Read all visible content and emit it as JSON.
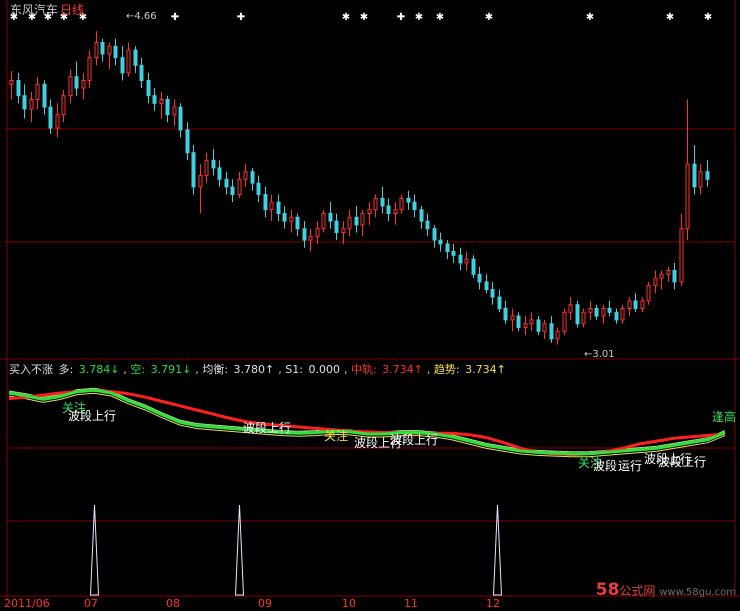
{
  "header": {
    "stock_name": "东风汽车",
    "period": "日线"
  },
  "price_labels": {
    "high": "4.66",
    "low": "3.01"
  },
  "indicator": {
    "name": "买入不涨",
    "items": [
      {
        "label": "多: ",
        "value": "3.784↓",
        "color": "g"
      },
      {
        "label": "空: ",
        "value": "3.791↓",
        "color": "g"
      },
      {
        "label": "均衡: ",
        "value": "3.780↑",
        "color": "w"
      },
      {
        "label": "S1: ",
        "value": "0.000",
        "color": "w"
      },
      {
        "label": "中轨: ",
        "value": "3.734↑",
        "color": "r"
      },
      {
        "label": "趋势: ",
        "value": "3.734↑",
        "color": "y"
      }
    ]
  },
  "signals": [
    {
      "text": "关注",
      "color": "g"
    },
    {
      "text": "波段上行",
      "color": "w"
    },
    {
      "text": "波段上行",
      "color": "w"
    },
    {
      "text": "关注",
      "color": "y"
    },
    {
      "text": "波段上行",
      "color": "w"
    },
    {
      "text": "波段上行",
      "color": "w"
    },
    {
      "text": "关注",
      "color": "g"
    },
    {
      "text": "波段",
      "color": "w"
    },
    {
      "text": "运行",
      "color": "w"
    },
    {
      "text": "波段上行",
      "color": "w"
    },
    {
      "text": "波段上行",
      "color": "w"
    },
    {
      "text": "逢高",
      "color": "g"
    }
  ],
  "dates": [
    "2011/06",
    "07",
    "08",
    "09",
    "10",
    "11",
    "12"
  ],
  "watermark": {
    "big": "58",
    "brand": "公式网",
    "site": "www.58gu.com"
  },
  "colors": {
    "up": "#ff3030",
    "down": "#40d0e0",
    "grid": "#800000",
    "trend": "#ff2020",
    "fast": "#30e040",
    "thin": "#e0e060"
  },
  "chart_data": {
    "type": "candlestick",
    "price_range": [
      2.95,
      4.75
    ],
    "candles": [
      [
        4.38,
        4.45,
        4.3,
        4.4
      ],
      [
        4.4,
        4.44,
        4.28,
        4.32
      ],
      [
        4.32,
        4.38,
        4.2,
        4.25
      ],
      [
        4.25,
        4.34,
        4.18,
        4.3
      ],
      [
        4.3,
        4.42,
        4.25,
        4.38
      ],
      [
        4.38,
        4.4,
        4.22,
        4.26
      ],
      [
        4.26,
        4.3,
        4.12,
        4.15
      ],
      [
        4.15,
        4.28,
        4.1,
        4.22
      ],
      [
        4.22,
        4.35,
        4.18,
        4.32
      ],
      [
        4.32,
        4.46,
        4.28,
        4.42
      ],
      [
        4.42,
        4.5,
        4.32,
        4.36
      ],
      [
        4.36,
        4.44,
        4.3,
        4.4
      ],
      [
        4.4,
        4.56,
        4.36,
        4.52
      ],
      [
        4.52,
        4.66,
        4.48,
        4.6
      ],
      [
        4.6,
        4.62,
        4.5,
        4.54
      ],
      [
        4.54,
        4.6,
        4.46,
        4.58
      ],
      [
        4.58,
        4.62,
        4.48,
        4.52
      ],
      [
        4.52,
        4.58,
        4.4,
        4.44
      ],
      [
        4.44,
        4.6,
        4.42,
        4.56
      ],
      [
        4.56,
        4.58,
        4.44,
        4.48
      ],
      [
        4.48,
        4.52,
        4.36,
        4.4
      ],
      [
        4.4,
        4.44,
        4.28,
        4.32
      ],
      [
        4.32,
        4.36,
        4.24,
        4.28
      ],
      [
        4.28,
        4.34,
        4.2,
        4.3
      ],
      [
        4.3,
        4.32,
        4.18,
        4.22
      ],
      [
        4.22,
        4.3,
        4.16,
        4.26
      ],
      [
        4.26,
        4.28,
        4.1,
        4.14
      ],
      [
        4.14,
        4.18,
        3.98,
        4.02
      ],
      [
        4.02,
        4.06,
        3.8,
        3.84
      ],
      [
        3.84,
        3.96,
        3.7,
        3.9
      ],
      [
        3.9,
        4.02,
        3.86,
        3.98
      ],
      [
        3.98,
        4.04,
        3.9,
        3.94
      ],
      [
        3.94,
        3.98,
        3.84,
        3.88
      ],
      [
        3.88,
        3.92,
        3.8,
        3.84
      ],
      [
        3.84,
        3.88,
        3.76,
        3.8
      ],
      [
        3.8,
        3.92,
        3.78,
        3.88
      ],
      [
        3.88,
        3.96,
        3.84,
        3.92
      ],
      [
        3.92,
        3.94,
        3.82,
        3.86
      ],
      [
        3.86,
        3.9,
        3.76,
        3.8
      ],
      [
        3.8,
        3.84,
        3.68,
        3.72
      ],
      [
        3.72,
        3.8,
        3.66,
        3.76
      ],
      [
        3.76,
        3.8,
        3.66,
        3.7
      ],
      [
        3.7,
        3.74,
        3.62,
        3.66
      ],
      [
        3.66,
        3.72,
        3.6,
        3.68
      ],
      [
        3.68,
        3.7,
        3.58,
        3.62
      ],
      [
        3.62,
        3.66,
        3.52,
        3.56
      ],
      [
        3.56,
        3.62,
        3.5,
        3.58
      ],
      [
        3.58,
        3.66,
        3.54,
        3.62
      ],
      [
        3.62,
        3.72,
        3.6,
        3.7
      ],
      [
        3.7,
        3.76,
        3.62,
        3.66
      ],
      [
        3.66,
        3.7,
        3.56,
        3.6
      ],
      [
        3.6,
        3.66,
        3.54,
        3.62
      ],
      [
        3.62,
        3.72,
        3.58,
        3.68
      ],
      [
        3.68,
        3.74,
        3.6,
        3.64
      ],
      [
        3.64,
        3.72,
        3.58,
        3.7
      ],
      [
        3.7,
        3.76,
        3.64,
        3.72
      ],
      [
        3.72,
        3.8,
        3.68,
        3.78
      ],
      [
        3.78,
        3.84,
        3.7,
        3.74
      ],
      [
        3.74,
        3.78,
        3.66,
        3.7
      ],
      [
        3.7,
        3.76,
        3.64,
        3.72
      ],
      [
        3.72,
        3.8,
        3.7,
        3.78
      ],
      [
        3.78,
        3.82,
        3.72,
        3.76
      ],
      [
        3.76,
        3.8,
        3.68,
        3.72
      ],
      [
        3.72,
        3.74,
        3.62,
        3.66
      ],
      [
        3.66,
        3.7,
        3.58,
        3.62
      ],
      [
        3.62,
        3.64,
        3.52,
        3.56
      ],
      [
        3.56,
        3.6,
        3.5,
        3.54
      ],
      [
        3.54,
        3.56,
        3.46,
        3.5
      ],
      [
        3.5,
        3.54,
        3.44,
        3.48
      ],
      [
        3.48,
        3.52,
        3.4,
        3.44
      ],
      [
        3.44,
        3.5,
        3.4,
        3.46
      ],
      [
        3.46,
        3.48,
        3.36,
        3.38
      ],
      [
        3.38,
        3.42,
        3.3,
        3.34
      ],
      [
        3.34,
        3.38,
        3.28,
        3.3
      ],
      [
        3.3,
        3.34,
        3.22,
        3.26
      ],
      [
        3.26,
        3.3,
        3.18,
        3.2
      ],
      [
        3.2,
        3.24,
        3.12,
        3.14
      ],
      [
        3.14,
        3.2,
        3.08,
        3.16
      ],
      [
        3.16,
        3.18,
        3.08,
        3.1
      ],
      [
        3.1,
        3.16,
        3.06,
        3.12
      ],
      [
        3.12,
        3.18,
        3.08,
        3.14
      ],
      [
        3.14,
        3.16,
        3.06,
        3.08
      ],
      [
        3.08,
        3.14,
        3.04,
        3.12
      ],
      [
        3.12,
        3.16,
        3.02,
        3.04
      ],
      [
        3.04,
        3.1,
        3.01,
        3.08
      ],
      [
        3.08,
        3.2,
        3.06,
        3.18
      ],
      [
        3.18,
        3.26,
        3.14,
        3.22
      ],
      [
        3.22,
        3.24,
        3.1,
        3.12
      ],
      [
        3.12,
        3.2,
        3.1,
        3.18
      ],
      [
        3.18,
        3.24,
        3.14,
        3.2
      ],
      [
        3.2,
        3.22,
        3.14,
        3.16
      ],
      [
        3.16,
        3.22,
        3.12,
        3.2
      ],
      [
        3.2,
        3.24,
        3.16,
        3.18
      ],
      [
        3.18,
        3.2,
        3.12,
        3.14
      ],
      [
        3.14,
        3.22,
        3.12,
        3.2
      ],
      [
        3.2,
        3.26,
        3.16,
        3.24
      ],
      [
        3.24,
        3.28,
        3.18,
        3.2
      ],
      [
        3.2,
        3.26,
        3.18,
        3.24
      ],
      [
        3.24,
        3.34,
        3.22,
        3.32
      ],
      [
        3.32,
        3.4,
        3.28,
        3.36
      ],
      [
        3.36,
        3.4,
        3.3,
        3.38
      ],
      [
        3.38,
        3.42,
        3.34,
        3.4
      ],
      [
        3.4,
        3.44,
        3.3,
        3.34
      ],
      [
        3.34,
        3.7,
        3.32,
        3.62
      ],
      [
        3.62,
        4.3,
        3.56,
        3.96
      ],
      [
        3.96,
        4.06,
        3.8,
        3.84
      ],
      [
        3.84,
        3.96,
        3.8,
        3.92
      ],
      [
        3.92,
        3.98,
        3.84,
        3.88
      ]
    ],
    "trend": [
      4.28,
      4.3,
      4.33,
      4.36,
      4.38,
      4.4,
      4.38,
      4.35,
      4.3,
      4.24,
      4.18,
      4.12,
      4.06,
      4.0,
      3.95,
      3.92,
      3.9,
      3.88,
      3.86,
      3.84,
      3.82,
      3.81,
      3.8,
      3.8,
      3.79,
      3.79,
      3.79,
      3.77,
      3.73,
      3.66,
      3.58,
      3.52,
      3.5,
      3.49,
      3.5,
      3.53,
      3.58,
      3.64,
      3.68,
      3.72,
      3.74,
      3.76,
      3.78
    ],
    "fast": [
      4.36,
      4.32,
      4.27,
      4.31,
      4.38,
      4.4,
      4.36,
      4.25,
      4.16,
      4.05,
      3.95,
      3.9,
      3.88,
      3.86,
      3.84,
      3.82,
      3.8,
      3.79,
      3.8,
      3.82,
      3.81,
      3.78,
      3.78,
      3.8,
      3.8,
      3.78,
      3.74,
      3.68,
      3.62,
      3.58,
      3.54,
      3.52,
      3.51,
      3.5,
      3.5,
      3.52,
      3.54,
      3.56,
      3.58,
      3.62,
      3.66,
      3.7,
      3.8
    ],
    "events": [
      14,
      36,
      76
    ]
  }
}
